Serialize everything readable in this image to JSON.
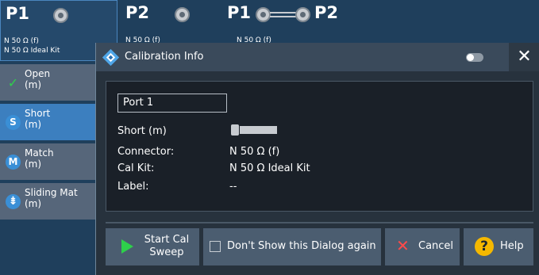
{
  "ports": [
    {
      "title": "P1",
      "line1": "N 50 Ω (f)",
      "line2": "N 50 Ω Ideal Kit"
    },
    {
      "title": "P2",
      "line1": "N 50 Ω (f)"
    },
    {
      "title_left": "P1",
      "title_right": "P2",
      "line1": "N 50 Ω (f)"
    }
  ],
  "standards": [
    {
      "label": "Open\n(m)",
      "icon": "check-icon"
    },
    {
      "label": "Short\n(m)",
      "icon": "S",
      "active": true
    },
    {
      "label": "Match\n(m)",
      "icon": "M"
    },
    {
      "label": "Sliding Mat\n(m)",
      "icon": "sliding-match-icon"
    }
  ],
  "dialog": {
    "title": "Calibration Info",
    "close": "✕",
    "port_field": "Port 1",
    "rows": [
      {
        "label": "Short (m)",
        "value": ""
      },
      {
        "label": "Connector:",
        "value": "N 50 Ω (f)"
      },
      {
        "label": "Cal Kit:",
        "value": "N 50 Ω Ideal Kit"
      },
      {
        "label": "Label:",
        "value": "--"
      }
    ],
    "buttons": {
      "start": "Start Cal\nSweep",
      "dont_show": "Don't Show this Dialog again",
      "cancel": "Cancel",
      "help": "Help"
    }
  },
  "colors": {
    "accent": "#3c7fbf",
    "play": "#2ed04b",
    "cancel": "#ff4a4a",
    "help": "#f5b800"
  }
}
